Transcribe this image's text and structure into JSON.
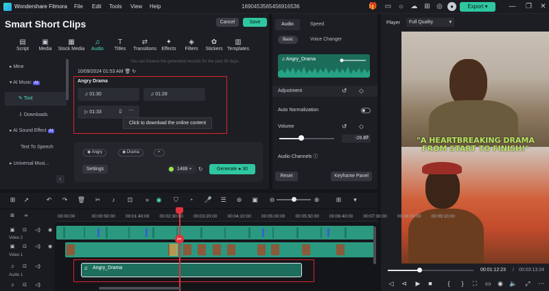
{
  "app": {
    "name": "Wondershare Filmora",
    "project_title": "1690453565456916536",
    "export_label": "Export"
  },
  "menu": [
    "File",
    "Edit",
    "Tools",
    "View",
    "Help"
  ],
  "panel": {
    "title": "Smart Short Clips",
    "cancel": "Cancel",
    "save": "Save"
  },
  "tools": [
    {
      "label": "Script",
      "icon": "script-icon"
    },
    {
      "label": "Media",
      "icon": "media-icon"
    },
    {
      "label": "Stock Media",
      "icon": "stock-media-icon"
    },
    {
      "label": "Audio",
      "icon": "music-note-icon"
    },
    {
      "label": "Titles",
      "icon": "titles-icon"
    },
    {
      "label": "Transitions",
      "icon": "transitions-icon"
    },
    {
      "label": "Effects",
      "icon": "effects-icon"
    },
    {
      "label": "Filters",
      "icon": "filters-icon"
    },
    {
      "label": "Stickers",
      "icon": "stickers-icon"
    },
    {
      "label": "Templates",
      "icon": "templates-icon"
    }
  ],
  "sidebar": {
    "items": [
      {
        "label": "Mine"
      },
      {
        "label": "AI Music",
        "badge": "AI"
      },
      {
        "label": "Tool"
      },
      {
        "label": "Downloads"
      },
      {
        "label": "AI Sound Effect",
        "badge": "AI"
      },
      {
        "label": "Text To Speech"
      },
      {
        "label": "Universal Musi..."
      }
    ]
  },
  "content": {
    "faint_note": "You can browse the generated records for the past 30 days.",
    "date": "10/09/2024 01:53 AM",
    "card_title": "Angry Drama",
    "clips": [
      "01:30",
      "01:28",
      "01:33"
    ],
    "tooltip": "Click to download the online content",
    "tags": [
      "Angry",
      "Drama",
      "+"
    ],
    "settings": "Settings",
    "credits": "1488",
    "generate": "Generate",
    "generate_cost": "30"
  },
  "audio_panel": {
    "tabs": [
      "Audio",
      "Speed"
    ],
    "subtabs": [
      "Basic",
      "Voice Changer"
    ],
    "clip_name": "Angry_Drama",
    "adjustment": "Adjustment",
    "auto_normalization": "Auto Normalization",
    "volume": "Volume",
    "volume_value": "-28.87",
    "volume_unit": "dB",
    "volume_level": 0.4,
    "audio_channels": "Audio Channels",
    "reset": "Reset",
    "keyframe": "Keyframe Panel"
  },
  "player": {
    "label": "Player",
    "quality": "Full Quality",
    "caption": "\"A HEARTBREAKING DRAMA FROM START TO FINISH!\"",
    "current_time": "00:01:12:23",
    "total_time": "00:03:13:24",
    "progress": 0.37
  },
  "timeline": {
    "ticks": [
      "00:00:00",
      "00:00:50:00",
      "00:01:40:00",
      "00:02:30:00",
      "00:03:20:00",
      "00:04:10:00",
      "00:05:00:00",
      "00:05:50:00",
      "00:06:40:00",
      "00:07:30:00",
      "00:08:20:00",
      "00:09:10:00"
    ],
    "tracks": [
      "Video 2",
      "Video 1",
      "Audio 1"
    ],
    "audio_clip": "Angry_Drama"
  }
}
